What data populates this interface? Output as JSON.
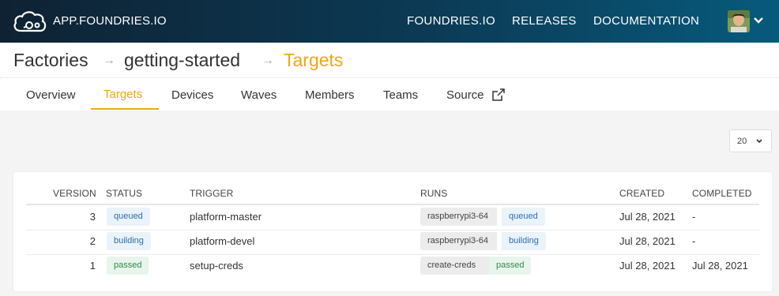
{
  "header": {
    "brand": "APP.FOUNDRIES.IO",
    "nav": [
      {
        "label": "FOUNDRIES.IO"
      },
      {
        "label": "RELEASES"
      },
      {
        "label": "DOCUMENTATION"
      }
    ]
  },
  "breadcrumb": {
    "items": [
      "Factories",
      "getting-started",
      "Targets"
    ],
    "separator": "→"
  },
  "tabs": [
    "Overview",
    "Targets",
    "Devices",
    "Waves",
    "Members",
    "Teams",
    "Source"
  ],
  "active_tab": "Targets",
  "page_size": {
    "value": "20"
  },
  "table": {
    "columns": [
      "VERSION",
      "STATUS",
      "TRIGGER",
      "RUNS",
      "CREATED",
      "COMPLETED"
    ],
    "rows": [
      {
        "version": "3",
        "status": "queued",
        "trigger": "platform-master",
        "run_name": "raspberrypi3-64",
        "run_status": "queued",
        "created": "Jul 28, 2021",
        "completed": "-"
      },
      {
        "version": "2",
        "status": "building",
        "trigger": "platform-devel",
        "run_name": "raspberrypi3-64",
        "run_status": "building",
        "created": "Jul 28, 2021",
        "completed": "-"
      },
      {
        "version": "1",
        "status": "passed",
        "trigger": "setup-creds",
        "run_name": "create-creds",
        "run_status": "passed",
        "created": "Jul 28, 2021",
        "completed": "Jul 28, 2021"
      }
    ]
  },
  "colors": {
    "accent": "#f0a612",
    "queued": "#2d6db1",
    "passed": "#2f8a4a",
    "header_dark": "#0e2233"
  }
}
